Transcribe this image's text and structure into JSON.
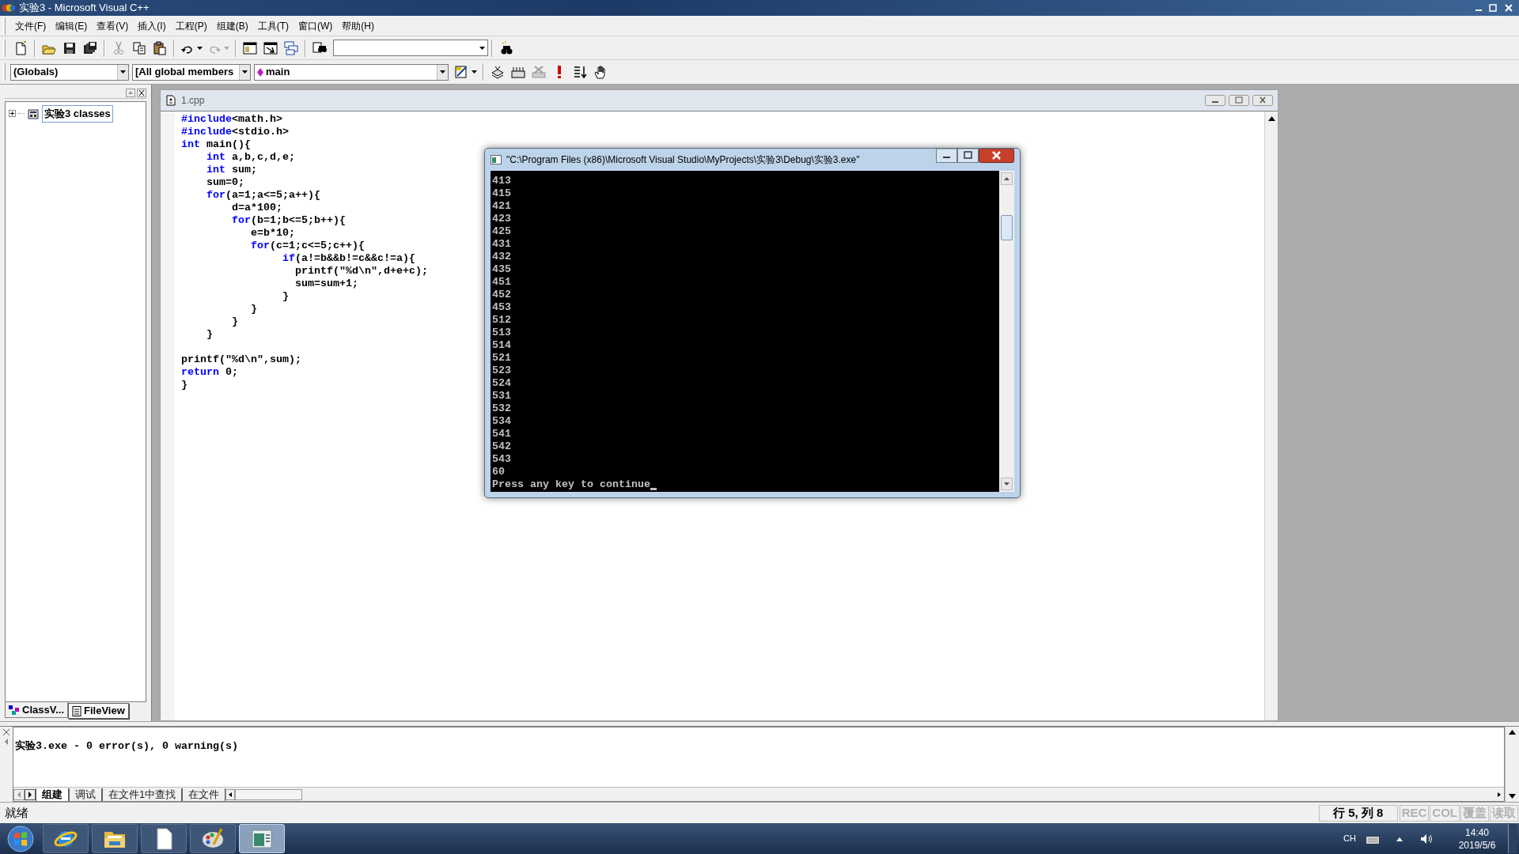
{
  "window": {
    "title": "实验3 - Microsoft Visual C++"
  },
  "menu": [
    "文件(F)",
    "编辑(E)",
    "查看(V)",
    "插入(I)",
    "工程(P)",
    "组建(B)",
    "工具(T)",
    "窗口(W)",
    "帮助(H)"
  ],
  "wizard_bar": {
    "scope": "(Globals)",
    "members": "[All global members",
    "function": "main"
  },
  "workspace": {
    "tree": [
      {
        "label": "实验3 classes",
        "expanded": false
      }
    ],
    "tabs": [
      {
        "label": "ClassV...",
        "selected": true
      },
      {
        "label": "FileView",
        "selected": false
      }
    ]
  },
  "editor": {
    "title": "1.cpp",
    "lines": [
      [
        {
          "text": "#include",
          "kind": "keyword"
        },
        {
          "text": "<math.h>",
          "kind": "plain"
        }
      ],
      [
        {
          "text": "#include",
          "kind": "keyword"
        },
        {
          "text": "<stdio.h>",
          "kind": "plain"
        }
      ],
      [
        {
          "text": "int",
          "kind": "keyword"
        },
        {
          "text": " main(){",
          "kind": "plain"
        }
      ],
      [
        {
          "text": "    int",
          "kind": "keyword"
        },
        {
          "text": " a,b,c,d,e;",
          "kind": "plain"
        }
      ],
      [
        {
          "text": "    int",
          "kind": "keyword"
        },
        {
          "text": " sum;",
          "kind": "plain"
        }
      ],
      [
        {
          "text": "    sum=0;",
          "kind": "plain"
        }
      ],
      [
        {
          "text": "    for",
          "kind": "keyword"
        },
        {
          "text": "(a=1;a<=5;a++){",
          "kind": "plain"
        }
      ],
      [
        {
          "text": "        d=a*100;",
          "kind": "plain"
        }
      ],
      [
        {
          "text": "        for",
          "kind": "keyword"
        },
        {
          "text": "(b=1;b<=5;b++){",
          "kind": "plain"
        }
      ],
      [
        {
          "text": "           e=b*10;",
          "kind": "plain"
        }
      ],
      [
        {
          "text": "           for",
          "kind": "keyword"
        },
        {
          "text": "(c=1;c<=5;c++){",
          "kind": "plain"
        }
      ],
      [
        {
          "text": "                if",
          "kind": "keyword"
        },
        {
          "text": "(a!=b&&b!=c&&c!=a){",
          "kind": "plain"
        }
      ],
      [
        {
          "text": "                  printf(\"%d\\n\",d+e+c);",
          "kind": "plain"
        }
      ],
      [
        {
          "text": "                  sum=sum+1;",
          "kind": "plain"
        }
      ],
      [
        {
          "text": "                }",
          "kind": "plain"
        }
      ],
      [
        {
          "text": "           }",
          "kind": "plain"
        }
      ],
      [
        {
          "text": "        }",
          "kind": "plain"
        }
      ],
      [
        {
          "text": "    }",
          "kind": "plain"
        }
      ],
      [
        {
          "text": "printf(\"%d\\n\",sum);",
          "kind": "plain",
          "space_before": true
        }
      ],
      [
        {
          "text": "return",
          "kind": "keyword"
        },
        {
          "text": " 0;",
          "kind": "plain"
        }
      ],
      [
        {
          "text": "}",
          "kind": "plain"
        }
      ]
    ]
  },
  "console": {
    "title": "\"C:\\Program Files (x86)\\Microsoft Visual Studio\\MyProjects\\实验3\\Debug\\实验3.exe\"",
    "lines": [
      "413",
      "415",
      "421",
      "423",
      "425",
      "431",
      "432",
      "435",
      "451",
      "452",
      "453",
      "512",
      "513",
      "514",
      "521",
      "523",
      "524",
      "531",
      "532",
      "534",
      "541",
      "542",
      "543",
      "60",
      "Press any key to continue"
    ]
  },
  "output": {
    "lines": [
      "实验3.exe - 0 error(s), 0 warning(s)"
    ],
    "tabs": [
      {
        "label": "组建",
        "selected": true
      },
      {
        "label": "调试",
        "selected": false
      },
      {
        "label": "在文件1中查找",
        "selected": false
      },
      {
        "label": "在文件",
        "selected": false
      }
    ]
  },
  "status_bar": {
    "message": "就绪",
    "position": "行 5, 列 8",
    "indicators": [
      {
        "label": "REC",
        "on": false
      },
      {
        "label": "COL",
        "on": false
      },
      {
        "label": "覆盖",
        "on": false
      },
      {
        "label": "读取",
        "on": false
      }
    ]
  },
  "taskbar": {
    "buttons": [
      {
        "kind": "browser",
        "selected": false
      },
      {
        "kind": "folder",
        "selected": false
      },
      {
        "kind": "document",
        "selected": false
      },
      {
        "kind": "paint",
        "selected": false
      },
      {
        "kind": "console",
        "selected": true
      }
    ],
    "language": "CH",
    "time": "14:40",
    "date": "2019/5/6"
  }
}
